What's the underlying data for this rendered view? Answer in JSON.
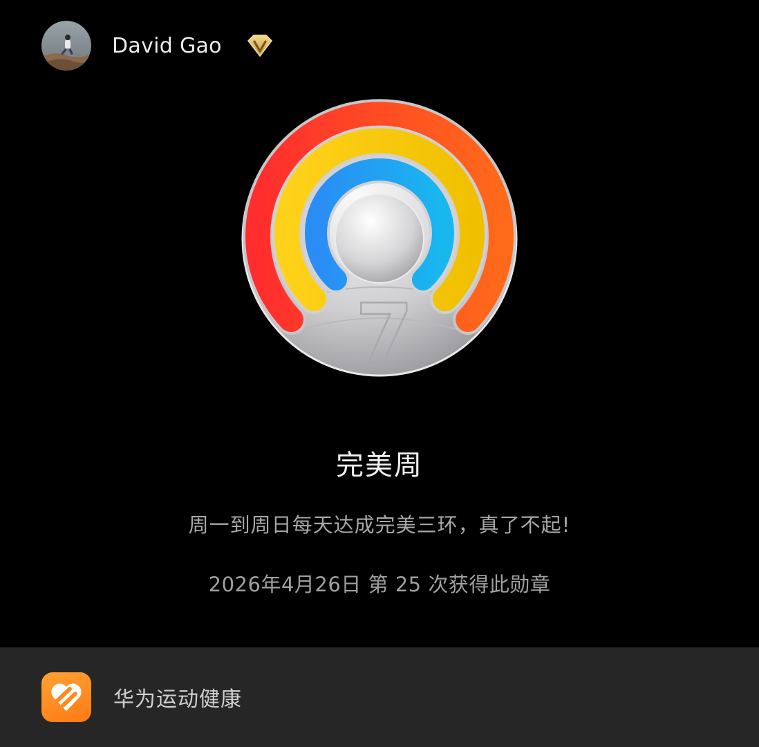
{
  "profile": {
    "username": "David Gao",
    "avatar_icon": "user-photo-avatar",
    "badge_icon": "vip-v-badge-icon"
  },
  "medal": {
    "icon": "perfect-week-medal",
    "number": "7",
    "rings": [
      "#ff3b2f",
      "#ffc800",
      "#1fa7f2"
    ],
    "title": "完美周",
    "description": "周一到周日每天达成完美三环，真了不起!",
    "earned_text": "2026年4月26日 第 25 次获得此勋章"
  },
  "footer": {
    "app_icon": "huawei-health-icon",
    "app_name": "华为运动健康",
    "brand_color": "#ff8a1f"
  }
}
